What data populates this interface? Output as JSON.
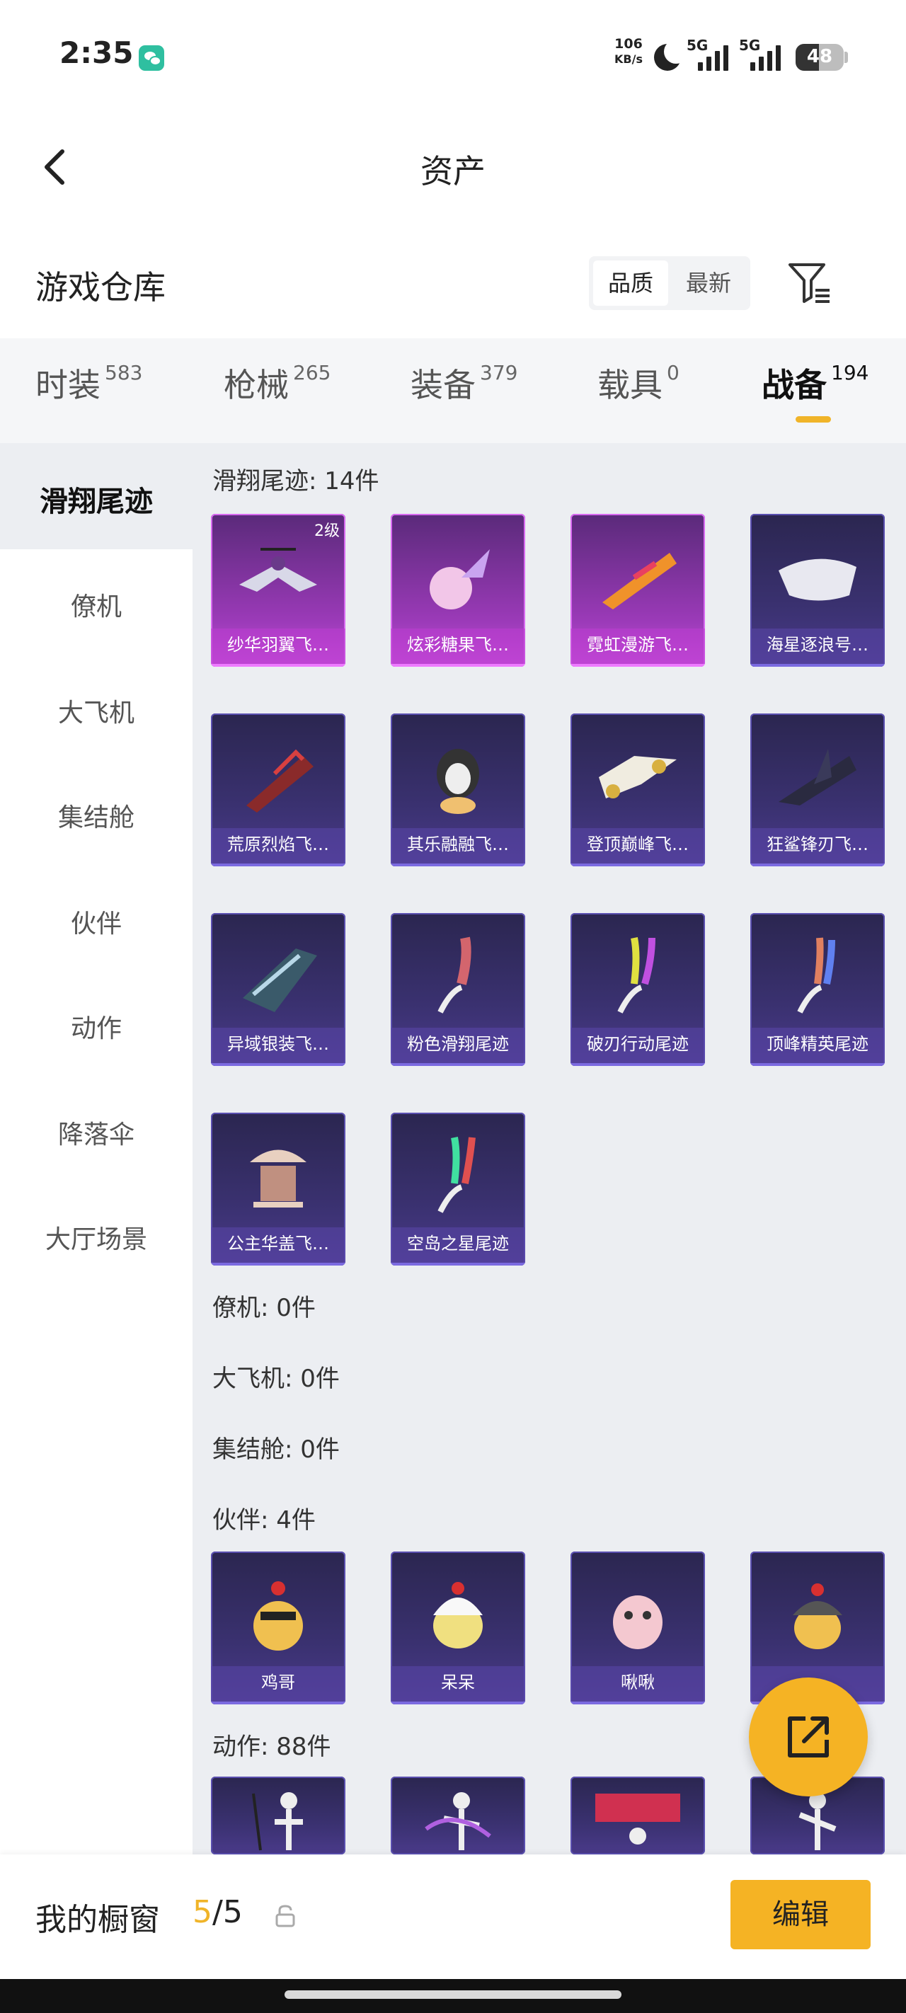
{
  "status": {
    "time": "2:35",
    "net_speed_value": "106",
    "net_speed_unit": "KB/s",
    "sim1": "5G",
    "sim2": "5G",
    "battery": "48"
  },
  "header": {
    "title": "资产"
  },
  "warehouse": {
    "title": "游戏仓库",
    "sort_quality": "品质",
    "sort_newest": "最新"
  },
  "tabs": [
    {
      "name": "时装",
      "count": "583"
    },
    {
      "name": "枪械",
      "count": "265"
    },
    {
      "name": "装备",
      "count": "379"
    },
    {
      "name": "载具",
      "count": "0"
    },
    {
      "name": "战备",
      "count": "194"
    }
  ],
  "sidebar": [
    "滑翔尾迹",
    "僚机",
    "大飞机",
    "集结舱",
    "伙伴",
    "动作",
    "降落伞",
    "大厅场景"
  ],
  "groups": {
    "glide": "滑翔尾迹: 14件",
    "wingman": "僚机: 0件",
    "plane": "大飞机: 0件",
    "pod": "集结舱: 0件",
    "partner": "伙伴: 4件",
    "action": "动作: 88件"
  },
  "glide_items": [
    {
      "name": "纱华羽翼飞…",
      "level": "2级"
    },
    {
      "name": "炫彩糖果飞…"
    },
    {
      "name": "霓虹漫游飞…"
    },
    {
      "name": "海星逐浪号…"
    },
    {
      "name": "荒原烈焰飞…"
    },
    {
      "name": "其乐融融飞…"
    },
    {
      "name": "登顶巅峰飞…"
    },
    {
      "name": "狂鲨锋刃飞…"
    },
    {
      "name": "异域银装飞…"
    },
    {
      "name": "粉色滑翔尾迹"
    },
    {
      "name": "破刃行动尾迹"
    },
    {
      "name": "顶峰精英尾迹"
    },
    {
      "name": "公主华盖飞…"
    },
    {
      "name": "空岛之星尾迹"
    }
  ],
  "partner_items": [
    {
      "name": "鸡哥"
    },
    {
      "name": "呆呆"
    },
    {
      "name": "啾啾"
    }
  ],
  "bottom": {
    "label": "我的橱窗",
    "current": "5",
    "total": "/5",
    "edit": "编辑"
  }
}
